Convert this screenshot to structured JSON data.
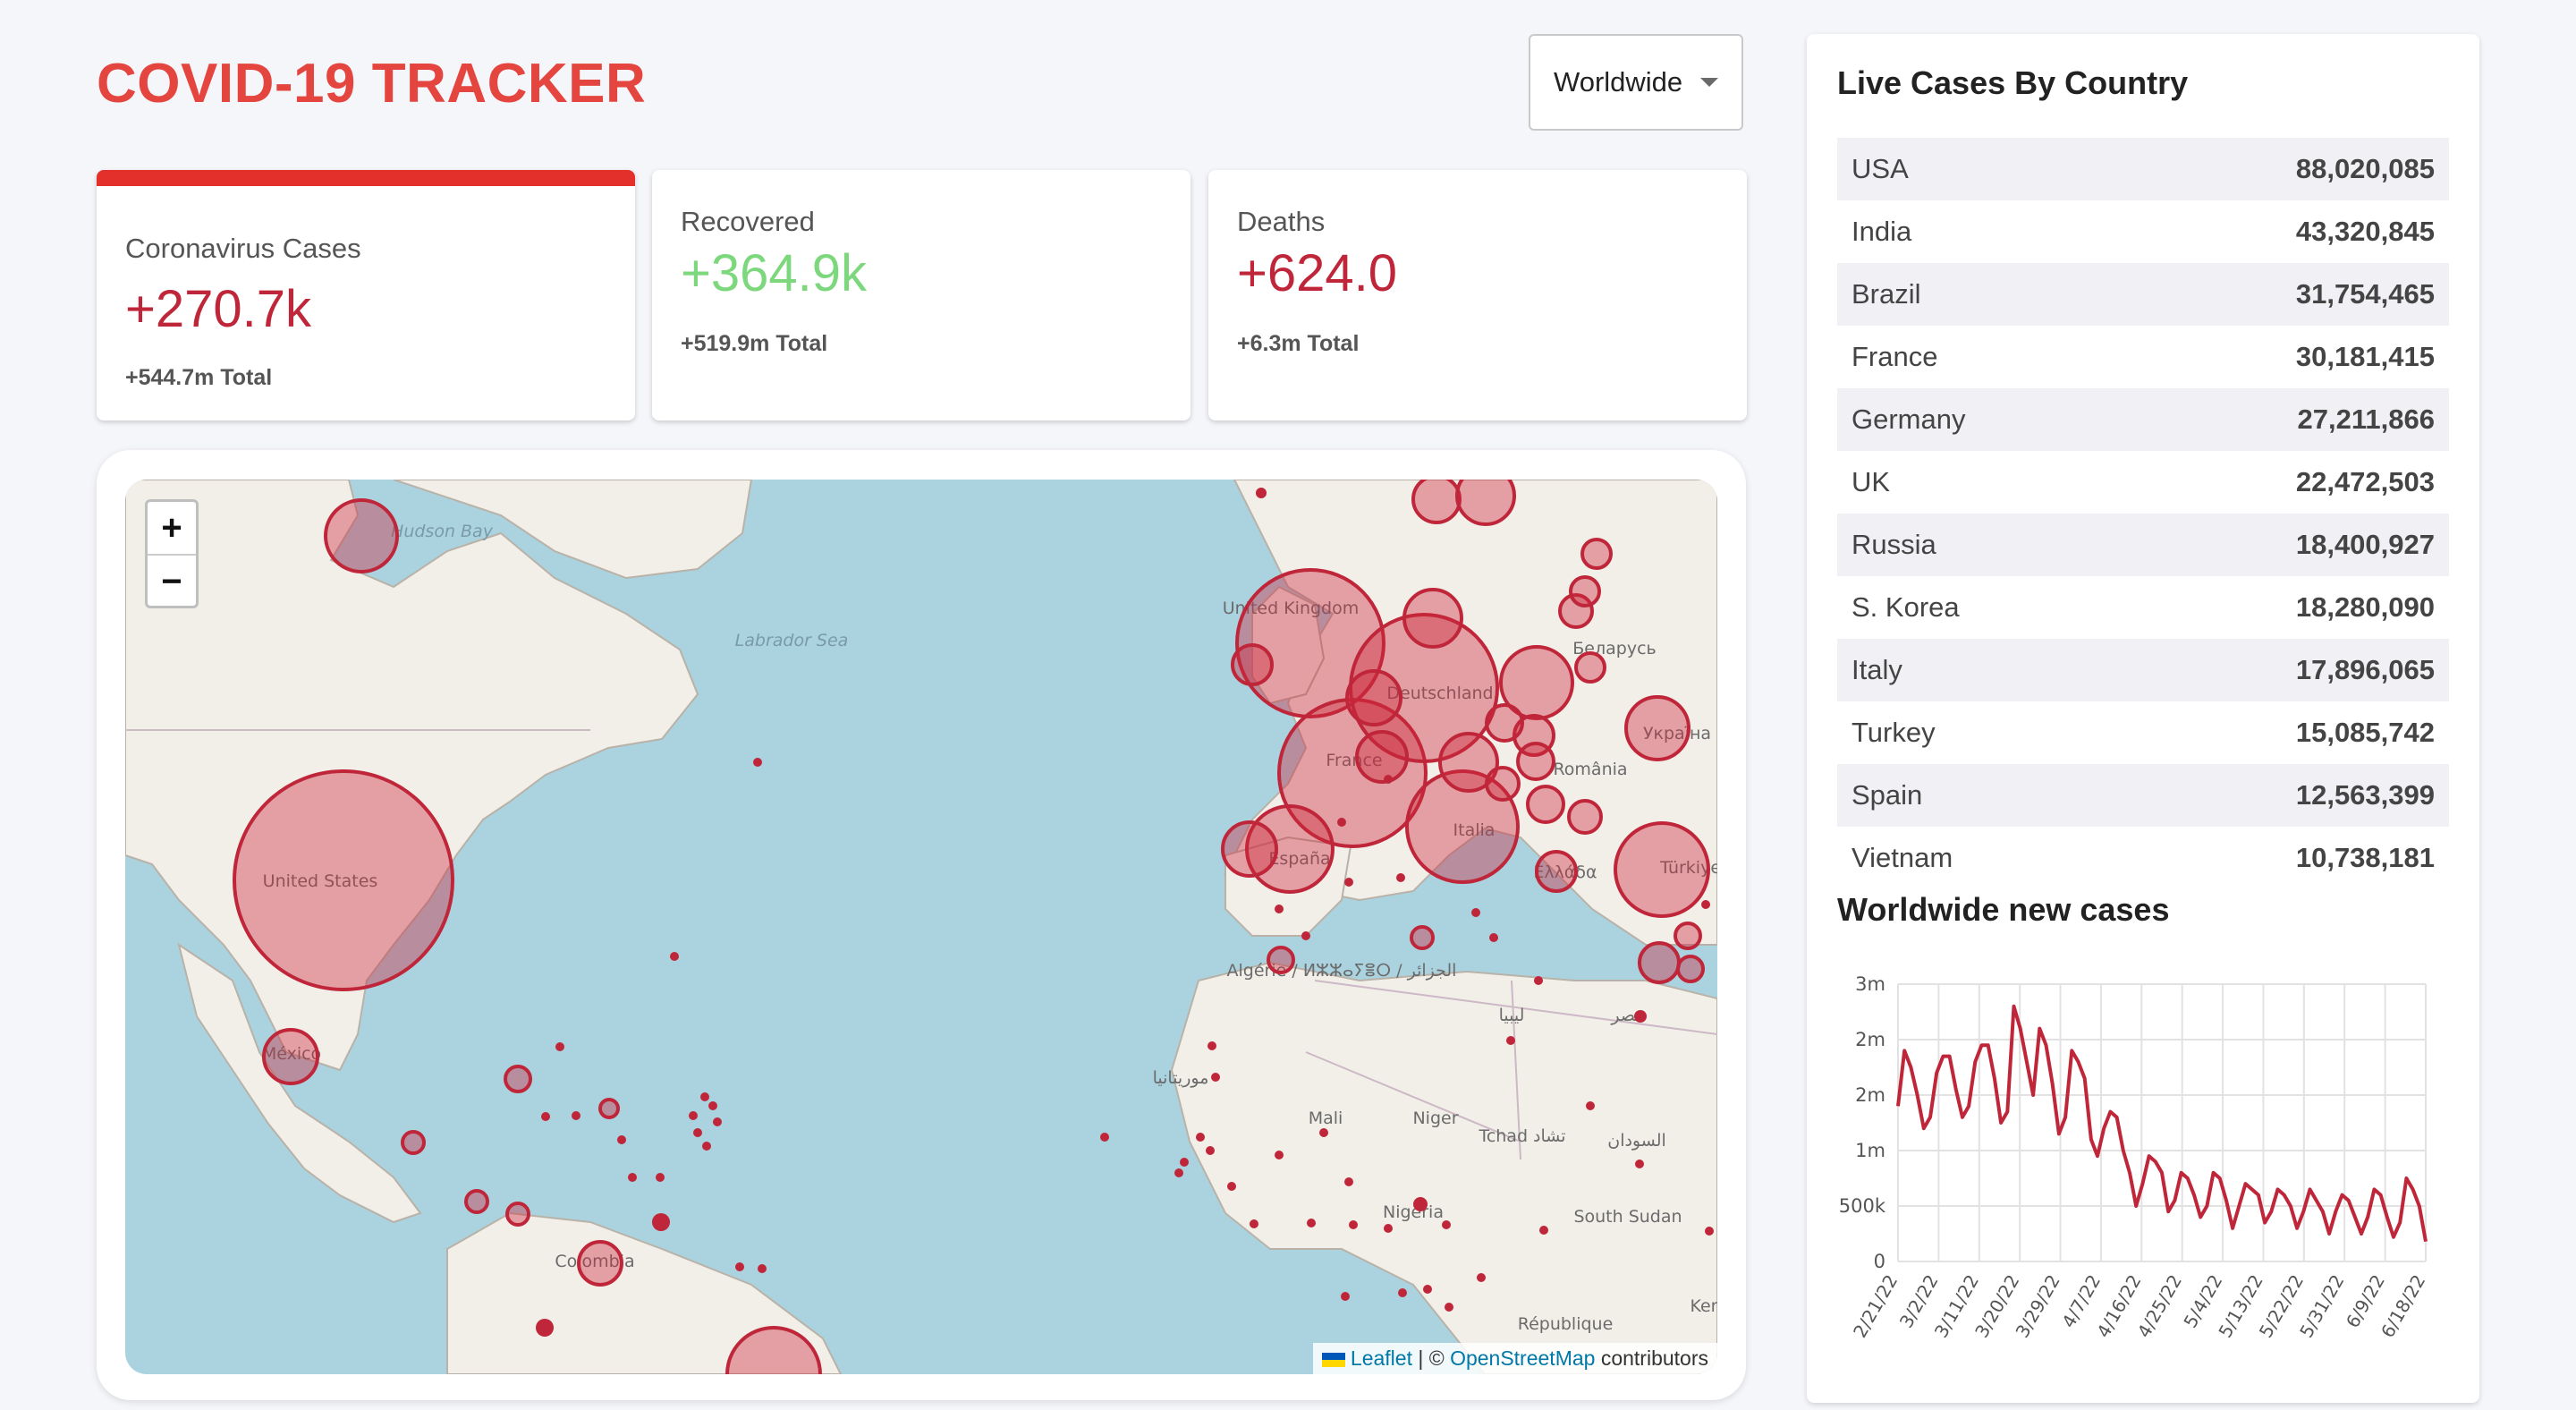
{
  "header": {
    "title": "COVID-19 TRACKER",
    "country_select": "Worldwide"
  },
  "cards": [
    {
      "label": "Coronavirus Cases",
      "value": "+270.7k",
      "total": "+544.7m Total",
      "color": "#c0263a"
    },
    {
      "label": "Recovered",
      "value": "+364.9k",
      "total": "+519.9m Total",
      "color": "#7dd87d"
    },
    {
      "label": "Deaths",
      "value": "+624.0",
      "total": "+6.3m Total",
      "color": "#c0263a"
    }
  ],
  "map": {
    "zoom_in": "+",
    "zoom_out": "−",
    "labels": {
      "hudson": "Hudson Bay",
      "labrador": "Labrador Sea",
      "us": "United States",
      "mexico": "México",
      "colombia": "Colombia",
      "uk": "United Kingdom",
      "france": "France",
      "deutschland": "Deutschland",
      "italia": "Italia",
      "espana": "España",
      "belarus": "Беларусь",
      "ukraine": "Україна",
      "romania": "România",
      "turkiye": "Türkiye",
      "ellada": "Ελλάδα",
      "algerie": "Algérie / ⵍⵣⵣⴰⵢⴻⵔ / الجزائر",
      "libya": "ليبيا",
      "mauritania": "موريتانيا",
      "mali": "Mali",
      "niger": "Niger",
      "tchad": "Tchad تشاد",
      "sudan": "السودان",
      "nigeria": "Nigeria",
      "south_sudan": "South Sudan",
      "rca": "République",
      "kenya": "Ker",
      "egypt": "مصر"
    },
    "attribution": {
      "leaflet": "Leaflet",
      "sep": " | © ",
      "osm": "OpenStreetMap",
      "tail": " contributors"
    }
  },
  "live_cases": {
    "title": "Live Cases By Country",
    "rows": [
      {
        "country": "USA",
        "cases": "88,020,085"
      },
      {
        "country": "India",
        "cases": "43,320,845"
      },
      {
        "country": "Brazil",
        "cases": "31,754,465"
      },
      {
        "country": "France",
        "cases": "30,181,415"
      },
      {
        "country": "Germany",
        "cases": "27,211,866"
      },
      {
        "country": "UK",
        "cases": "22,472,503"
      },
      {
        "country": "Russia",
        "cases": "18,400,927"
      },
      {
        "country": "S. Korea",
        "cases": "18,280,090"
      },
      {
        "country": "Italy",
        "cases": "17,896,065"
      },
      {
        "country": "Turkey",
        "cases": "15,085,742"
      },
      {
        "country": "Spain",
        "cases": "12,563,399"
      },
      {
        "country": "Vietnam",
        "cases": "10,738,181"
      }
    ]
  },
  "chart_data": {
    "type": "line",
    "title": "Worldwide new cases",
    "y_ticks": [
      "0",
      "500k",
      "1m",
      "2m",
      "2m",
      "3m"
    ],
    "y_tick_values": [
      0,
      500000,
      1000000,
      1500000,
      2000000,
      2500000
    ],
    "ylim": [
      0,
      2500000
    ],
    "x_ticks": [
      "2/21/22",
      "3/2/22",
      "3/11/22",
      "3/20/22",
      "3/29/22",
      "4/7/22",
      "4/16/22",
      "4/25/22",
      "5/4/22",
      "5/13/22",
      "5/22/22",
      "5/31/22",
      "6/9/22",
      "6/18/22"
    ],
    "color": "#c0263a",
    "grid": true,
    "series": [
      {
        "values": [
          1400000,
          1900000,
          1750000,
          1500000,
          1200000,
          1300000,
          1700000,
          1850000,
          1850000,
          1550000,
          1300000,
          1400000,
          1800000,
          1950000,
          1950000,
          1650000,
          1250000,
          1350000,
          2300000,
          2100000,
          1800000,
          1500000,
          2100000,
          1950000,
          1600000,
          1150000,
          1300000,
          1900000,
          1800000,
          1650000,
          1100000,
          950000,
          1200000,
          1350000,
          1300000,
          1000000,
          800000,
          500000,
          700000,
          950000,
          900000,
          800000,
          450000,
          550000,
          800000,
          750000,
          600000,
          400000,
          500000,
          800000,
          750000,
          550000,
          300000,
          500000,
          700000,
          650000,
          600000,
          350000,
          450000,
          650000,
          600000,
          500000,
          300000,
          450000,
          650000,
          550000,
          450000,
          250000,
          450000,
          600000,
          550000,
          400000,
          250000,
          400000,
          650000,
          600000,
          400000,
          220000,
          350000,
          750000,
          650000,
          500000,
          180000
        ]
      }
    ]
  }
}
